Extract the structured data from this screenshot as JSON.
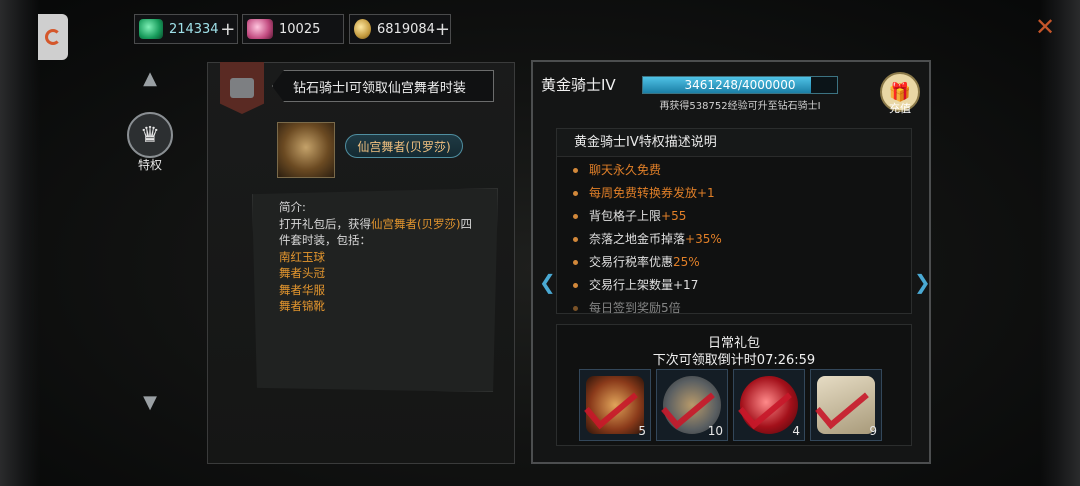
{
  "currencies": [
    {
      "icon": "green-gem-icon",
      "value": "214334",
      "has_plus": true
    },
    {
      "icon": "pink-gem-icon",
      "value": "10025",
      "has_plus": false
    },
    {
      "icon": "gold-coins-icon",
      "value": "6819084",
      "has_plus": true
    }
  ],
  "plus_label": "+",
  "nav": {
    "privilege_label": "特权"
  },
  "left": {
    "banner_title": "钻石骑士I可领取仙宫舞者时装",
    "item_name": "仙宫舞者(贝罗莎)",
    "desc_label": "简介:",
    "desc_line1": "打开礼包后，获得",
    "desc_highlight": "仙宫舞者(贝罗莎)",
    "desc_line1_end": "四",
    "desc_line2": "件套时装，包括：",
    "items": [
      "南红玉球",
      "舞者头冠",
      "舞者华服",
      "舞者锦靴"
    ]
  },
  "right": {
    "rank_title": "黄金骑士IV",
    "xp_text": "3461248/4000000",
    "xp_fraction": 0.865,
    "xp_hint": "再获得538752经验可升至钻石骑士I",
    "recharge_label": "充值",
    "perks_title": "黄金骑士IV特权描述说明",
    "perks": [
      {
        "text": "聊天永久免费",
        "highlight": "",
        "all_orange": true
      },
      {
        "text": "每周免费转换券发放+1",
        "highlight": "",
        "all_orange": true
      },
      {
        "text": "背包格子上限",
        "highlight": "+55",
        "all_orange": false
      },
      {
        "text": "奈落之地金币掉落",
        "highlight": "+35%",
        "all_orange": false
      },
      {
        "text": "交易行税率优惠",
        "highlight": "25%",
        "all_orange": false
      },
      {
        "text": "交易行上架数量+17",
        "highlight": "",
        "all_orange": false
      },
      {
        "text": "每日签到奖励5倍",
        "highlight": "",
        "all_orange": false
      }
    ],
    "daily_title": "日常礼包",
    "daily_countdown": "下次可领取倒计时07:26:59",
    "rewards": [
      {
        "icon": "potion-bottle-icon",
        "qty": "5"
      },
      {
        "icon": "medal-badge-icon",
        "qty": "10"
      },
      {
        "icon": "red-orb-icon",
        "qty": "4"
      },
      {
        "icon": "scroll-icon",
        "qty": "9"
      }
    ]
  }
}
